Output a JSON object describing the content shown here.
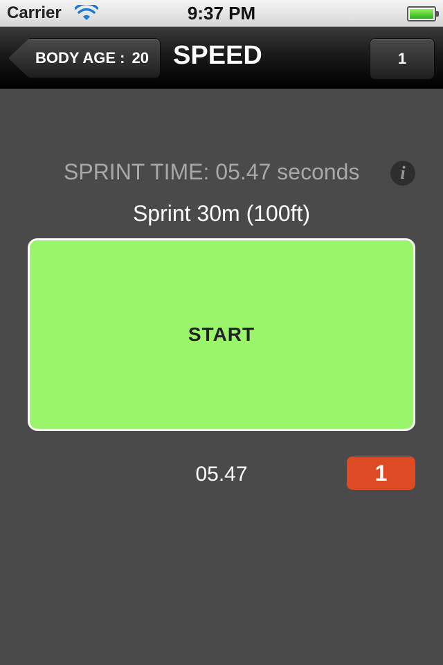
{
  "status_bar": {
    "carrier": "Carrier",
    "time": "9:37 PM",
    "icons": [
      "wifi-icon",
      "battery-icon"
    ],
    "battery_color": "#39c12a"
  },
  "nav_bar": {
    "back_label": "BODY AGE :",
    "back_value": "20",
    "title": "SPEED",
    "right_button_label": "1"
  },
  "content": {
    "sprint_time_text": "SPRINT TIME: 05.47 seconds",
    "info_icon_glyph": "i",
    "sprint_label": "Sprint 30m (100ft)",
    "start_button_label": "START",
    "start_button_color": "#9bf56a",
    "result_time": "05.47",
    "result_badge": "1",
    "result_badge_color": "#dd4a23"
  }
}
